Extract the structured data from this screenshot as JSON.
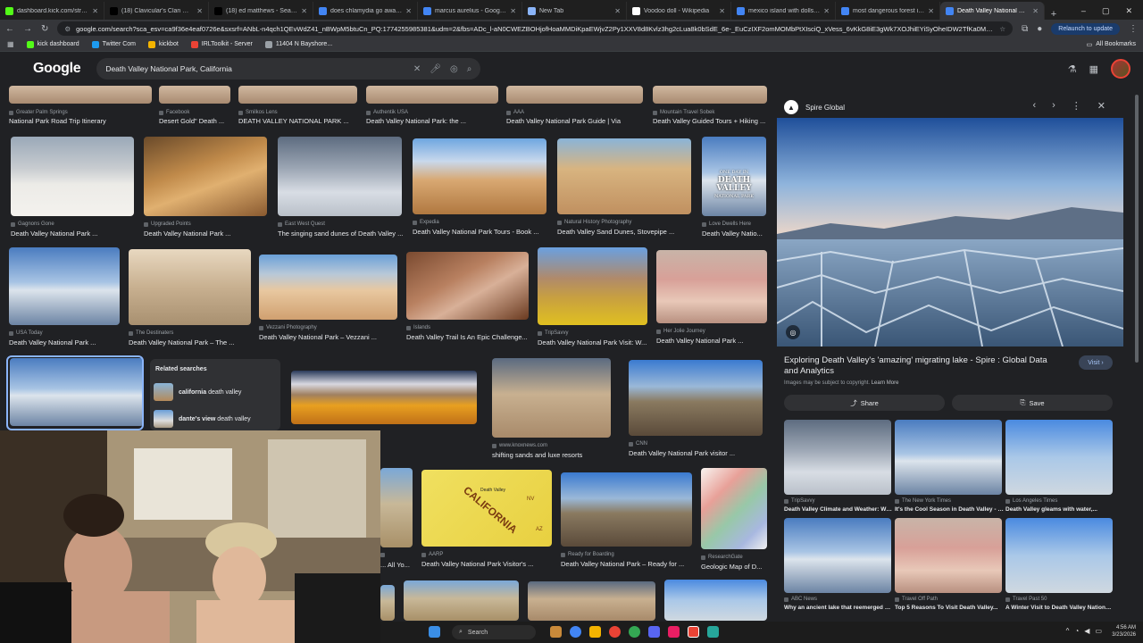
{
  "tabs": [
    {
      "title": "dashboard.kick.com/stream",
      "fav": "#53fc18"
    },
    {
      "title": "(18) Clavicular's Clan Commun",
      "fav": "#000000"
    },
    {
      "title": "(18) ed matthews - Search / X",
      "fav": "#000000"
    },
    {
      "title": "does chlamydia go away - Goo",
      "fav": "#4285f4"
    },
    {
      "title": "marcus aurelius - Google Sear",
      "fav": "#4285f4"
    },
    {
      "title": "New Tab",
      "fav": "#8ab4f8"
    },
    {
      "title": "Voodoo doll - Wikipedia",
      "fav": "#ffffff"
    },
    {
      "title": "mexico island with dolls - Goo",
      "fav": "#4285f4"
    },
    {
      "title": "most dangerous forest in ame",
      "fav": "#4285f4"
    },
    {
      "title": "Death Valley National Park, Ca",
      "fav": "#4285f4",
      "active": true
    }
  ],
  "new_tab": "+",
  "window_controls": {
    "min": "–",
    "max": "▢",
    "close": "✕"
  },
  "url": "google.com/search?sca_esv=ca9f36e4eaf0726e&sxsrf=ANbL-n4qch1QEvWdZ41_nBWpM5btuCn_PQ:1774255985381&udm=2&fbs=ADc_l-aN0CWEZBOHjofHoaMMDiKpaEWjvZ2Py1XXV8d8Kvlz3hg2cLua8k0bSdE_6e-_EuCzIXF2omMOMbPtXIsciQ_xVess_6vKkG8iE3gWk7XOJhiEYiSyOheIDW2TfKa0MDJ_ddQsSxKg3e_trko_",
  "relaunch": "Relaunch to update",
  "bookmarks": [
    {
      "label": "kick dashboard",
      "color": "#53fc18"
    },
    {
      "label": "Twitter Com",
      "color": "#1d9bf0"
    },
    {
      "label": "kickbot",
      "color": "#f4b400"
    },
    {
      "label": "IRLToolkit - Server",
      "color": "#ea4335"
    },
    {
      "label": "11404 N Bayshore...",
      "color": "#9aa0a6"
    }
  ],
  "all_bookmarks": "All Bookmarks",
  "header": {
    "logo": "Google",
    "query": "Death Valley National Park, California"
  },
  "results_top": [
    {
      "source": "Greater Palm Springs",
      "title": "National Park Road Trip Itinerary"
    },
    {
      "source": "Facebook",
      "title": "Desert Gold\" Death ..."
    },
    {
      "source": "Smilkos Lens",
      "title": "DEATH VALLEY NATIONAL PARK ..."
    },
    {
      "source": "Authentik USA",
      "title": "Death Valley National Park: the ..."
    },
    {
      "source": "AAA",
      "title": "Death Valley National Park Guide | Via"
    },
    {
      "source": "Mountain Travel Sobek",
      "title": "Death Valley Guided Tours + Hiking ..."
    }
  ],
  "results_row1": [
    {
      "source": "Gagnons Gone",
      "title": "Death Valley National Park ..."
    },
    {
      "source": "Upgraded Points",
      "title": "Death Valley National Park ..."
    },
    {
      "source": "East West Quest",
      "title": "The singing sand dunes of Death Valley ..."
    },
    {
      "source": "Expedia",
      "title": "Death Valley National Park Tours - Book ..."
    },
    {
      "source": "Natural History Photography",
      "title": "Death Valley Sand Dunes, Stovepipe ..."
    },
    {
      "source": "Love Dwells Here",
      "title": "Death Valley Natio..."
    }
  ],
  "dv_badge": {
    "top": "ONE DAY IN",
    "mid": "DEATH VALLEY",
    "bottom": "NATIONAL PARK"
  },
  "results_row2": [
    {
      "source": "USA Today",
      "title": "Death Valley National Park ..."
    },
    {
      "source": "The Destinaters",
      "title": "Death Valley National Park – The ..."
    },
    {
      "source": "Vezzani Photography",
      "title": "Death Valley National Park – Vezzani ..."
    },
    {
      "source": "Islands",
      "title": "Death Valley Trail Is An Epic Challenge..."
    },
    {
      "source": "TripSavvy",
      "title": "Death Valley National Park Visit: W..."
    },
    {
      "source": "Her Jolie Journey",
      "title": "Death Valley National Park ..."
    }
  ],
  "related": {
    "heading": "Related searches",
    "items": [
      {
        "bold": "california",
        "rest": " death valley"
      },
      {
        "bold": "dante's view",
        "rest": " death valley"
      }
    ]
  },
  "results_row3": [
    {
      "source": "www.knoxnews.com",
      "title": "shifting sands and luxe resorts"
    },
    {
      "source": "CNN",
      "title": "Death Valley National Park visitor ..."
    }
  ],
  "results_row4": [
    {
      "source": "",
      "title": "... All Yo..."
    },
    {
      "source": "AARP",
      "title": "Death Valley National Park Visitor's ..."
    },
    {
      "source": "Ready for Boarding",
      "title": "Death Valley National Park – Ready for ..."
    },
    {
      "source": "ResearchGate",
      "title": "Geologic Map of D..."
    }
  ],
  "map_labels": {
    "state": "CALIFORNIA",
    "place": "Death Valley",
    "nv": "NV",
    "az": "AZ"
  },
  "panel": {
    "source": "Spire Global",
    "title": "Exploring Death Valley's 'amazing' migrating lake - Spire : Global Data and Analytics",
    "visit": "Visit",
    "copyright": "Images may be subject to copyright.",
    "learn_more": "Learn More",
    "share": "Share",
    "save": "Save",
    "related": [
      {
        "source": "TripSavvy",
        "title": "Death Valley Climate and Weather: Wha..."
      },
      {
        "source": "The New York Times",
        "title": "It's the Cool Season in Death Valley - T..."
      },
      {
        "source": "Los Angeles Times",
        "title": "Death Valley gleams with water,..."
      },
      {
        "source": "ABC News",
        "title": "Why an ancient lake that reemerged at..."
      },
      {
        "source": "Travel Off Path",
        "title": "Top 5 Reasons To Visit Death Valley..."
      },
      {
        "source": "Travel Past 50",
        "title": "A Winter Visit to Death Valley National..."
      }
    ]
  },
  "taskbar": {
    "search": "Search",
    "time": "4:56 AM",
    "date": "3/23/2026"
  }
}
